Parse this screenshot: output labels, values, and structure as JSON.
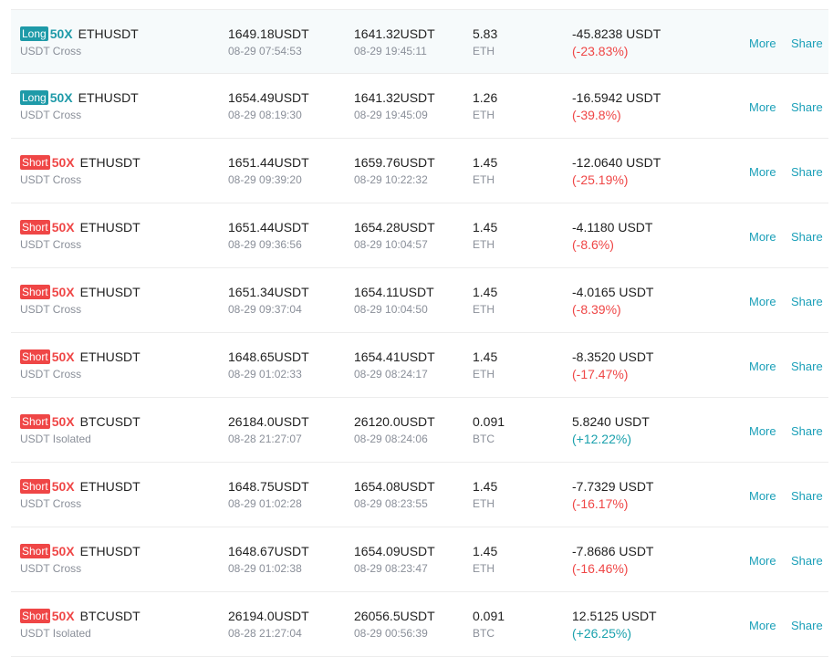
{
  "colors": {
    "long": "#1e9aa8",
    "short": "#ef4646",
    "negative": "#ef4646",
    "positive": "#1aa1ad",
    "action": "#1a9fb8"
  },
  "actions": {
    "more": "More",
    "share": "Share"
  },
  "rows": [
    {
      "side": "Long",
      "leverage": "50X",
      "pair": "ETHUSDT",
      "margin": "USDT Cross",
      "entry_price": "1649.18USDT",
      "entry_time": "08-29 07:54:53",
      "close_price": "1641.32USDT",
      "close_time": "08-29 19:45:11",
      "size": "5.83",
      "size_unit": "ETH",
      "pnl": "-45.8238 USDT",
      "pnl_pct": "(-23.83%)",
      "pnl_sign": "neg"
    },
    {
      "side": "Long",
      "leverage": "50X",
      "pair": "ETHUSDT",
      "margin": "USDT Cross",
      "entry_price": "1654.49USDT",
      "entry_time": "08-29 08:19:30",
      "close_price": "1641.32USDT",
      "close_time": "08-29 19:45:09",
      "size": "1.26",
      "size_unit": "ETH",
      "pnl": "-16.5942 USDT",
      "pnl_pct": "(-39.8%)",
      "pnl_sign": "neg"
    },
    {
      "side": "Short",
      "leverage": "50X",
      "pair": "ETHUSDT",
      "margin": "USDT Cross",
      "entry_price": "1651.44USDT",
      "entry_time": "08-29 09:39:20",
      "close_price": "1659.76USDT",
      "close_time": "08-29 10:22:32",
      "size": "1.45",
      "size_unit": "ETH",
      "pnl": "-12.0640 USDT",
      "pnl_pct": "(-25.19%)",
      "pnl_sign": "neg"
    },
    {
      "side": "Short",
      "leverage": "50X",
      "pair": "ETHUSDT",
      "margin": "USDT Cross",
      "entry_price": "1651.44USDT",
      "entry_time": "08-29 09:36:56",
      "close_price": "1654.28USDT",
      "close_time": "08-29 10:04:57",
      "size": "1.45",
      "size_unit": "ETH",
      "pnl": "-4.1180 USDT",
      "pnl_pct": "(-8.6%)",
      "pnl_sign": "neg"
    },
    {
      "side": "Short",
      "leverage": "50X",
      "pair": "ETHUSDT",
      "margin": "USDT Cross",
      "entry_price": "1651.34USDT",
      "entry_time": "08-29 09:37:04",
      "close_price": "1654.11USDT",
      "close_time": "08-29 10:04:50",
      "size": "1.45",
      "size_unit": "ETH",
      "pnl": "-4.0165 USDT",
      "pnl_pct": "(-8.39%)",
      "pnl_sign": "neg"
    },
    {
      "side": "Short",
      "leverage": "50X",
      "pair": "ETHUSDT",
      "margin": "USDT Cross",
      "entry_price": "1648.65USDT",
      "entry_time": "08-29 01:02:33",
      "close_price": "1654.41USDT",
      "close_time": "08-29 08:24:17",
      "size": "1.45",
      "size_unit": "ETH",
      "pnl": "-8.3520 USDT",
      "pnl_pct": "(-17.47%)",
      "pnl_sign": "neg"
    },
    {
      "side": "Short",
      "leverage": "50X",
      "pair": "BTCUSDT",
      "margin": "USDT Isolated",
      "entry_price": "26184.0USDT",
      "entry_time": "08-28 21:27:07",
      "close_price": "26120.0USDT",
      "close_time": "08-29 08:24:06",
      "size": "0.091",
      "size_unit": "BTC",
      "pnl": "5.8240 USDT",
      "pnl_pct": "(+12.22%)",
      "pnl_sign": "pos"
    },
    {
      "side": "Short",
      "leverage": "50X",
      "pair": "ETHUSDT",
      "margin": "USDT Cross",
      "entry_price": "1648.75USDT",
      "entry_time": "08-29 01:02:28",
      "close_price": "1654.08USDT",
      "close_time": "08-29 08:23:55",
      "size": "1.45",
      "size_unit": "ETH",
      "pnl": "-7.7329 USDT",
      "pnl_pct": "(-16.17%)",
      "pnl_sign": "neg"
    },
    {
      "side": "Short",
      "leverage": "50X",
      "pair": "ETHUSDT",
      "margin": "USDT Cross",
      "entry_price": "1648.67USDT",
      "entry_time": "08-29 01:02:38",
      "close_price": "1654.09USDT",
      "close_time": "08-29 08:23:47",
      "size": "1.45",
      "size_unit": "ETH",
      "pnl": "-7.8686 USDT",
      "pnl_pct": "(-16.46%)",
      "pnl_sign": "neg"
    },
    {
      "side": "Short",
      "leverage": "50X",
      "pair": "BTCUSDT",
      "margin": "USDT Isolated",
      "entry_price": "26194.0USDT",
      "entry_time": "08-28 21:27:04",
      "close_price": "26056.5USDT",
      "close_time": "08-29 00:56:39",
      "size": "0.091",
      "size_unit": "BTC",
      "pnl": "12.5125 USDT",
      "pnl_pct": "(+26.25%)",
      "pnl_sign": "pos"
    }
  ]
}
